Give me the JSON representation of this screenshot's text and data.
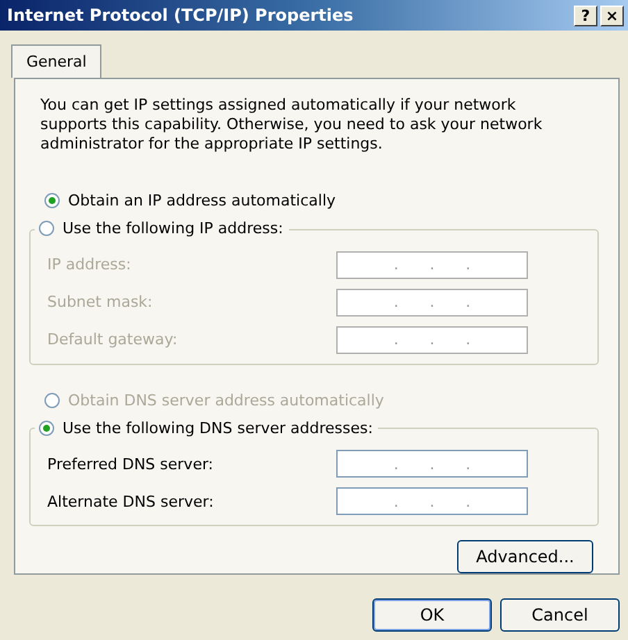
{
  "window": {
    "title": "Internet Protocol (TCP/IP) Properties",
    "controls": [
      "?",
      "×"
    ]
  },
  "tabs": [
    {
      "label": "General",
      "selected": true
    }
  ],
  "description": "You can get IP settings assigned automatically if your network supports this capability. Otherwise, you need to ask your network administrator for the appropriate IP settings.",
  "ip_options": [
    {
      "label": "Obtain an IP address automatically",
      "selected": true,
      "disabled": false
    },
    {
      "label": "Use the following IP address:",
      "selected": false,
      "disabled": false
    }
  ],
  "ip_fields": [
    {
      "label": "IP address:",
      "disabled": true,
      "separator": "."
    },
    {
      "label": "Subnet mask:",
      "disabled": true,
      "separator": "."
    },
    {
      "label": "Default gateway:",
      "disabled": true,
      "separator": "."
    }
  ],
  "dns_options": [
    {
      "label": "Obtain DNS server address automatically",
      "selected": false,
      "disabled": true
    },
    {
      "label": "Use the following DNS server addresses:",
      "selected": true,
      "disabled": false
    }
  ],
  "dns_fields": [
    {
      "label": "Preferred DNS server:",
      "disabled": false,
      "separator": "."
    },
    {
      "label": "Alternate DNS server:",
      "disabled": false,
      "separator": "."
    }
  ],
  "advanced_button": "Advanced...",
  "buttons": [
    {
      "label": "OK",
      "kind": "default"
    },
    {
      "label": "Cancel",
      "kind": "normal"
    }
  ]
}
